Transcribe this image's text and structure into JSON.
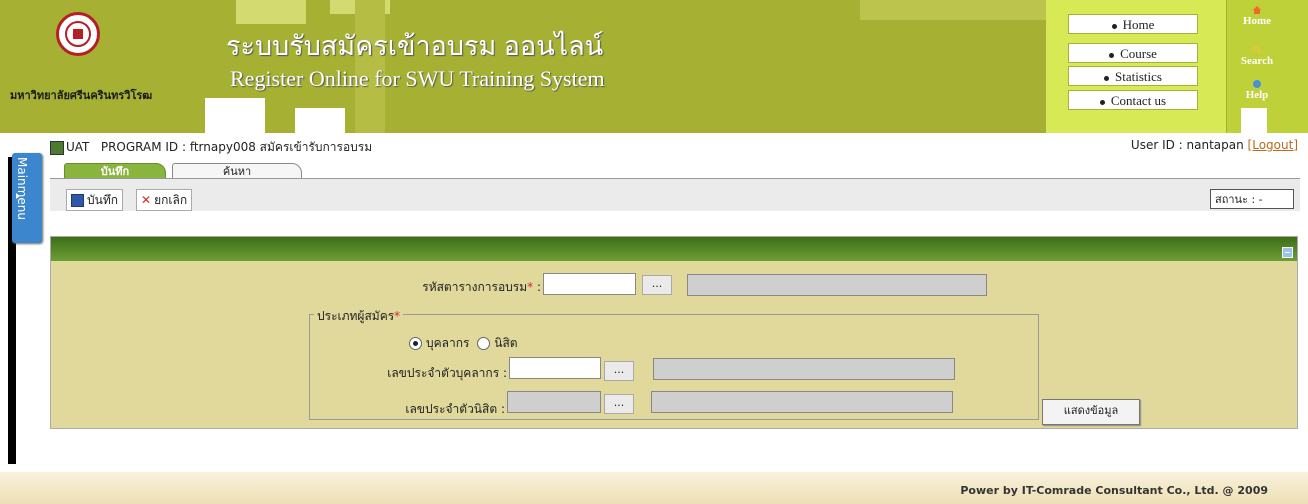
{
  "header": {
    "university_name": "มหาวิทยาลัยศรีนครินทรวิโรฒ",
    "title_th": "ระบบรับสมัครเข้าอบรม ออนไลน์",
    "title_en": "Register Online for  SWU Training System",
    "top_menu": [
      "Home",
      "Course",
      "Statistics",
      "Contact us"
    ],
    "right_nav": [
      {
        "label": "Home",
        "icon": "home-icon"
      },
      {
        "label": "Search",
        "icon": "search-icon"
      },
      {
        "label": "Help",
        "icon": "help-icon"
      }
    ]
  },
  "sidebar": {
    "mainmenu_label": "Mainmenu"
  },
  "program": {
    "env": "UAT",
    "program_text": "PROGRAM ID : ftrnapy008 สมัครเข้ารับการอบรม",
    "user_text": "User ID : nantapan ",
    "logout": "[Logout]"
  },
  "tabs": [
    "บันทึก",
    "ค้นหา"
  ],
  "toolbar": {
    "save_label": "บันทึก",
    "cancel_label": "ยกเลิก",
    "status_label": "สถานะ : -"
  },
  "form": {
    "course_code_label": "รหัสตารางการอบรม",
    "applicant_type_legend": "ประเภทผู้สมัคร",
    "radio_staff": "บุคลากร",
    "radio_student": "นิสิต",
    "staff_id_label": "เลขประจำตัวบุคลากร :",
    "student_id_label": "เลขประจำตัวนิสิต :",
    "browse_label": "...",
    "show_button": "แสดงข้อมูล",
    "selected_type": "staff"
  },
  "footer": {
    "text": "Power by IT-Comrade Consultant Co., Ltd. @ 2009"
  }
}
